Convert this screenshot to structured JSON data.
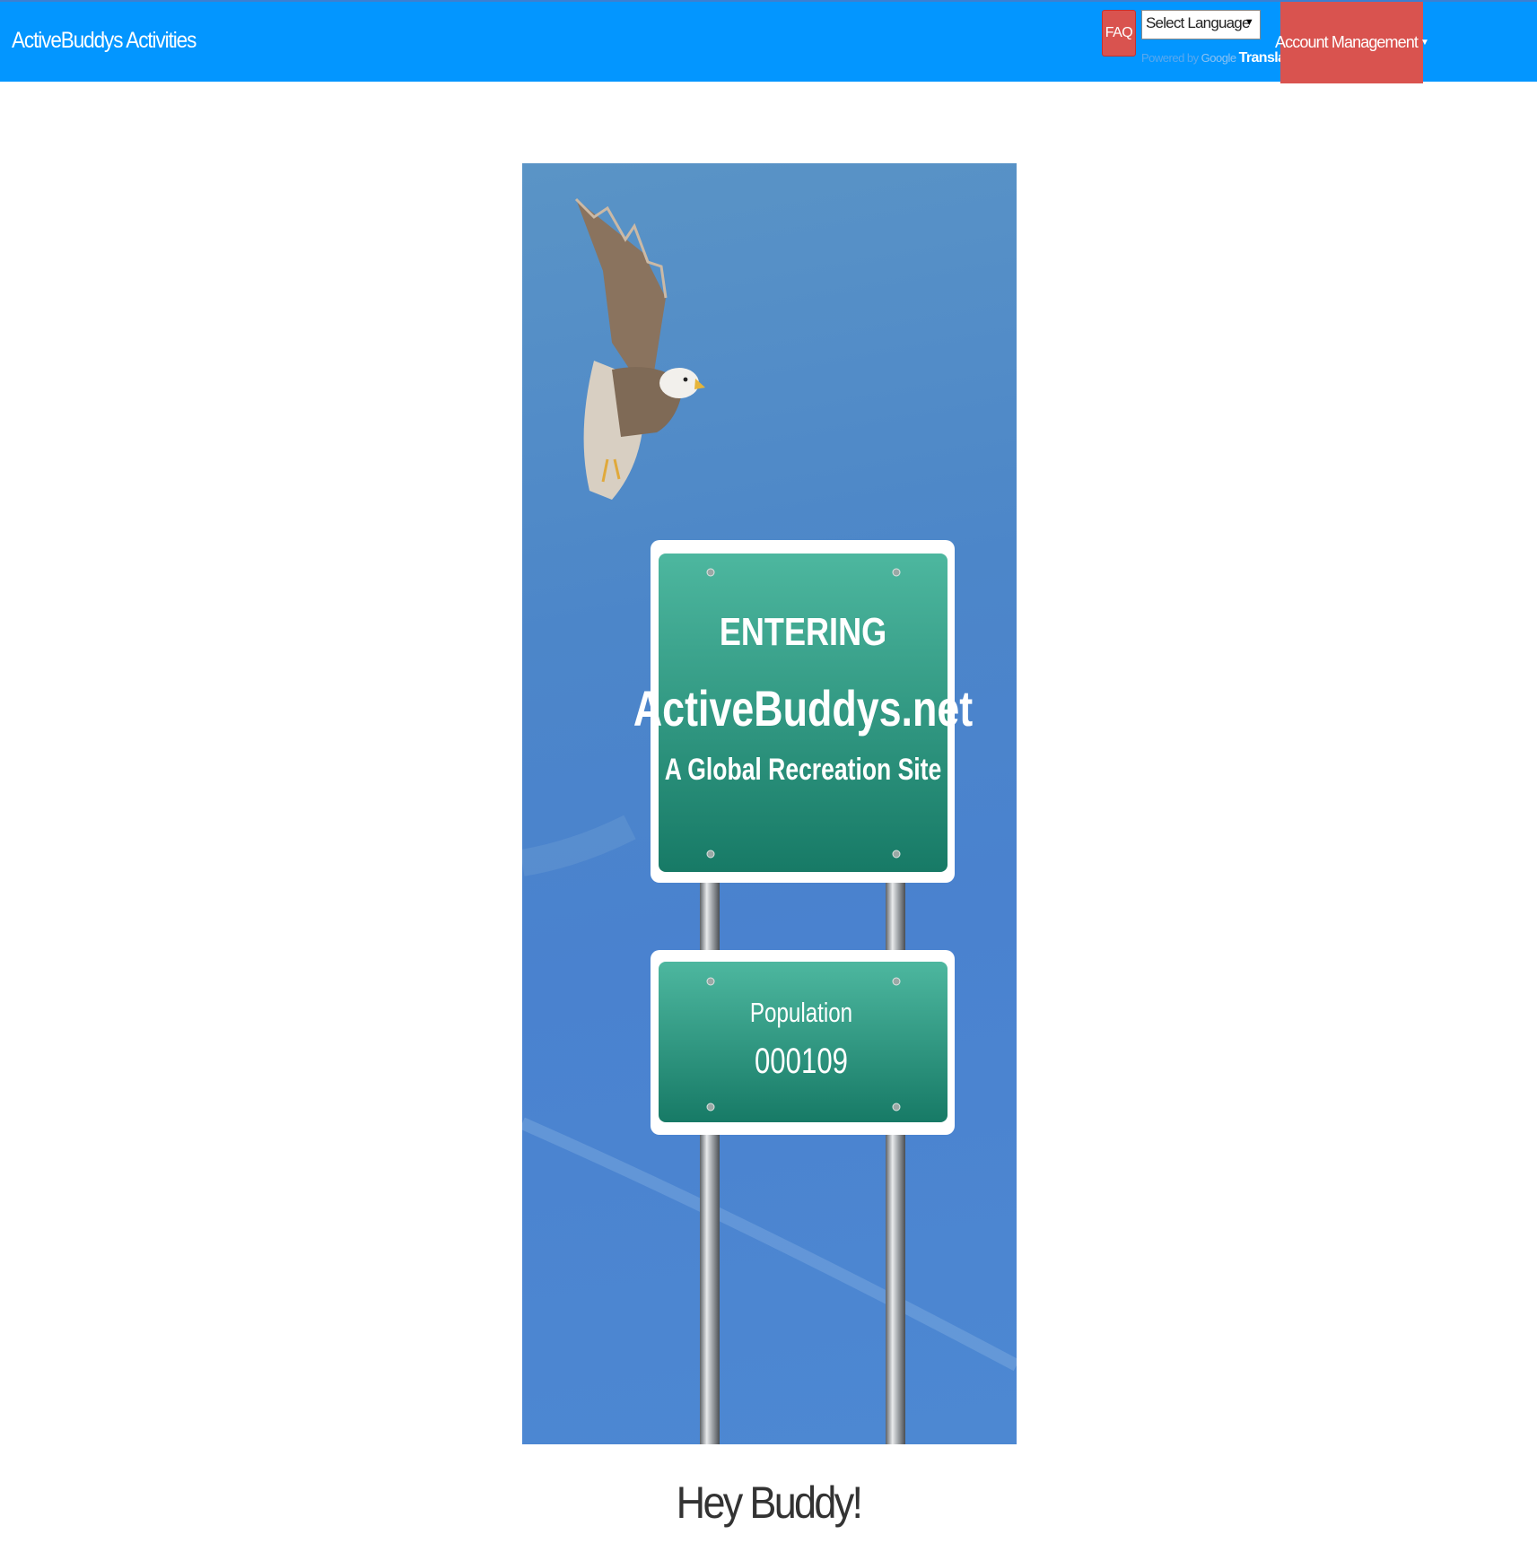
{
  "navbar": {
    "brand": "ActiveBuddys Activities",
    "faq_label": "FAQ",
    "language_select": {
      "selected": "Select Language"
    },
    "powered_by": "Powered by",
    "google_label": "Google",
    "translate_label": "Translate",
    "account_label": "Account Management"
  },
  "hero": {
    "sign_top": {
      "line1": "ENTERING",
      "line2": "ActiveBuddys.net",
      "line3": "A Global Recreation Site"
    },
    "sign_bottom": {
      "label": "Population",
      "value": "000109"
    }
  },
  "greeting": "Hey Buddy!",
  "colors": {
    "navbar_bg": "#0396ff",
    "danger": "#d9534f",
    "sign_green": "#23906f",
    "sky": "#4a82cf"
  }
}
